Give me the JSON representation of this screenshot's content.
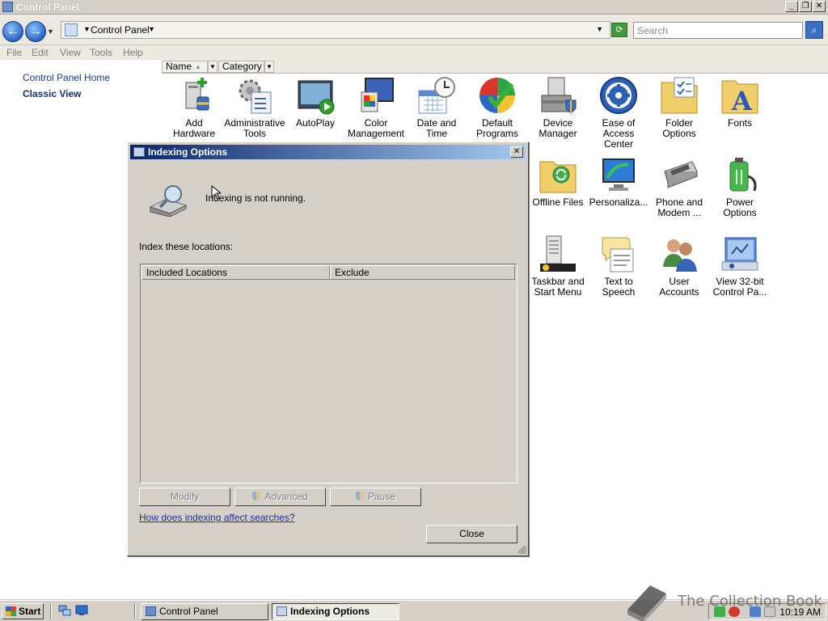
{
  "window": {
    "title": "Control Panel",
    "min_glyph": "_",
    "max_glyph": "❐",
    "close_glyph": "✕"
  },
  "address": {
    "back_glyph": "←",
    "forward_glyph": "→",
    "location": "Control Panel",
    "search_placeholder": "Search"
  },
  "menu": [
    "File",
    "Edit",
    "View",
    "Tools",
    "Help"
  ],
  "leftpane": {
    "home_link": "Control Panel Home",
    "classic_view": "Classic View"
  },
  "columns": {
    "name": "Name",
    "category": "Category"
  },
  "icons": [
    {
      "label": "Add Hardware",
      "icon": "add-hardware-icon"
    },
    {
      "label": "Administrative Tools",
      "icon": "administrative-tools-icon"
    },
    {
      "label": "AutoPlay",
      "icon": "autoplay-icon"
    },
    {
      "label": "Color Management",
      "icon": "color-management-icon"
    },
    {
      "label": "Date and Time",
      "icon": "date-time-icon"
    },
    {
      "label": "Default Programs",
      "icon": "default-programs-icon"
    },
    {
      "label": "Device Manager",
      "icon": "device-manager-icon"
    },
    {
      "label": "Ease of Access Center",
      "icon": "ease-of-access-icon"
    },
    {
      "label": "Folder Options",
      "icon": "folder-options-icon"
    },
    {
      "label": "Fonts",
      "icon": "fonts-icon"
    },
    {
      "label": "Offline Files",
      "icon": "offline-files-icon"
    },
    {
      "label": "Personaliza...",
      "icon": "personalization-icon"
    },
    {
      "label": "Phone and Modem ...",
      "icon": "phone-modem-icon"
    },
    {
      "label": "Power Options",
      "icon": "power-options-icon"
    },
    {
      "label": "Taskbar and Start Menu",
      "icon": "taskbar-start-menu-icon"
    },
    {
      "label": "Text to Speech",
      "icon": "text-to-speech-icon"
    },
    {
      "label": "User Accounts",
      "icon": "user-accounts-icon"
    },
    {
      "label": "View 32-bit Control Pa...",
      "icon": "view-32bit-control-panel-icon"
    }
  ],
  "dialog": {
    "title": "Indexing Options",
    "close_glyph": "✕",
    "status": "Indexing is not running.",
    "index_label": "Index these locations:",
    "col_included": "Included Locations",
    "col_exclude": "Exclude",
    "modify": "Modify",
    "advanced": "Advanced",
    "pause": "Pause",
    "help_link": "How does indexing affect searches?",
    "close": "Close"
  },
  "taskbar": {
    "start": "Start",
    "tasks": [
      "Control Panel",
      "Indexing Options"
    ],
    "clock": "10:19 AM"
  },
  "watermark": "The Collection Book",
  "colors": {
    "dialog_title_start": "#0a246a",
    "dialog_title_end": "#a6caf0",
    "link": "#1c2f9b",
    "face": "#d4d0c8"
  }
}
